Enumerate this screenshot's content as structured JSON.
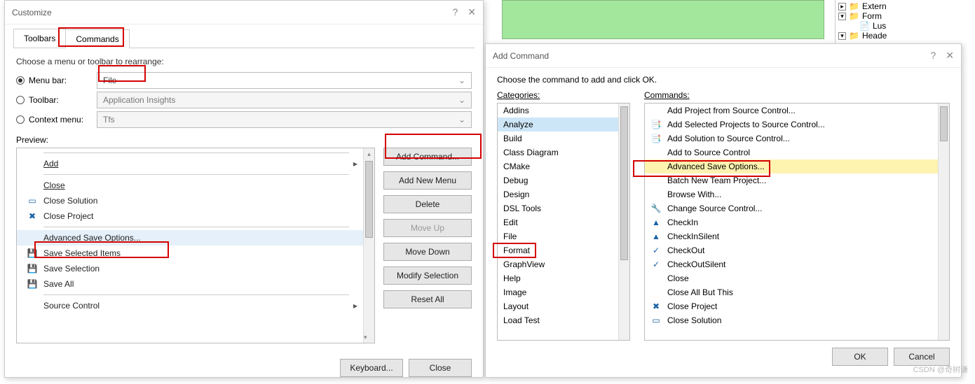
{
  "customize": {
    "title": "Customize",
    "tabs": {
      "toolbars": "Toolbars",
      "commands": "Commands"
    },
    "choose": "Choose a menu or toolbar to rearrange:",
    "radios": {
      "menubar": "Menu bar:",
      "toolbar": "Toolbar:",
      "context": "Context menu:"
    },
    "selects": {
      "menubar": "File",
      "toolbar": "Application Insights",
      "context": "Tfs"
    },
    "preview_label": "Preview:",
    "preview": {
      "add": "Add",
      "close": "Close",
      "close_solution": "Close Solution",
      "close_project": "Close Project",
      "adv_save": "Advanced Save Options...",
      "save_selected": "Save Selected Items",
      "save_selection": "Save Selection",
      "save_all": "Save All",
      "source_control": "Source Control"
    },
    "buttons": {
      "add_command": "Add Command...",
      "add_menu": "Add New Menu",
      "delete": "Delete",
      "move_up": "Move Up",
      "move_down": "Move Down",
      "modify": "Modify Selection",
      "reset": "Reset All"
    },
    "footer": {
      "keyboard": "Keyboard...",
      "close": "Close"
    }
  },
  "addcmd": {
    "title": "Add Command",
    "prompt": "Choose the command to add and click OK.",
    "cat_label": "Categories:",
    "cmd_label": "Commands:",
    "categories": [
      "Addins",
      "Analyze",
      "Build",
      "Class Diagram",
      "CMake",
      "Debug",
      "Design",
      "DSL Tools",
      "Edit",
      "File",
      "Format",
      "GraphView",
      "Help",
      "Image",
      "Layout",
      "Load Test"
    ],
    "commands": [
      {
        "icon": "",
        "text": "Add Project from Source Control..."
      },
      {
        "icon": "📑",
        "text": "Add Selected Projects to Source Control..."
      },
      {
        "icon": "📑",
        "text": "Add Solution to Source Control..."
      },
      {
        "icon": "",
        "text": "Add to Source Control"
      },
      {
        "icon": "",
        "text": "Advanced Save Options...",
        "sel": true
      },
      {
        "icon": "",
        "text": "Batch New Team Project..."
      },
      {
        "icon": "",
        "text": "Browse With..."
      },
      {
        "icon": "🔧",
        "text": "Change Source Control..."
      },
      {
        "icon": "▲",
        "text": "CheckIn"
      },
      {
        "icon": "▲",
        "text": "CheckInSilent"
      },
      {
        "icon": "✓",
        "text": "CheckOut"
      },
      {
        "icon": "✓",
        "text": "CheckOutSilent"
      },
      {
        "icon": "",
        "text": "Close"
      },
      {
        "icon": "",
        "text": "Close All But This"
      },
      {
        "icon": "✖",
        "text": "Close Project"
      },
      {
        "icon": "▭",
        "text": "Close Solution"
      }
    ],
    "ok": "OK",
    "cancel": "Cancel"
  },
  "tree": {
    "extern": "Extern",
    "form": "Form",
    "lus": "Lus",
    "header": "Heade"
  },
  "watermark": "CSDN @奇树谦"
}
